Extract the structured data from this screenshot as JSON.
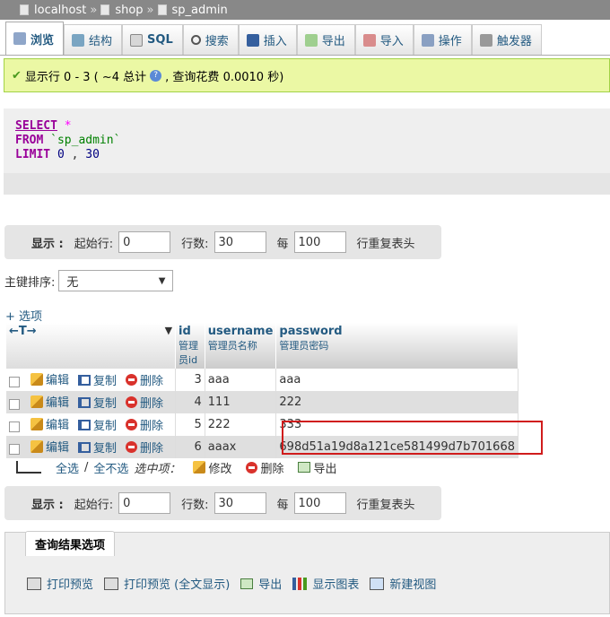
{
  "breadcrumb": {
    "server": "localhost",
    "database": "shop",
    "table": "sp_admin",
    "separator": "»"
  },
  "tabs": [
    {
      "label": "浏览",
      "icon": "browse-icon",
      "active": true
    },
    {
      "label": "结构",
      "icon": "structure-icon"
    },
    {
      "label": "SQL",
      "icon": "sql-icon"
    },
    {
      "label": "搜索",
      "icon": "search-icon"
    },
    {
      "label": "插入",
      "icon": "insert-icon"
    },
    {
      "label": "导出",
      "icon": "export-icon"
    },
    {
      "label": "导入",
      "icon": "import-icon"
    },
    {
      "label": "操作",
      "icon": "wrench-icon"
    },
    {
      "label": "触发器",
      "icon": "trigger-icon"
    }
  ],
  "success": {
    "text_a": "显示行 0 - 3 ( ~4 总计",
    "text_b": ", 查询花费 0.0010 秒)"
  },
  "sql": {
    "select": "SELECT",
    "star": "*",
    "from": "FROM",
    "table": "`sp_admin`",
    "limit": "LIMIT",
    "offset": "0",
    "comma": ",",
    "count": "30"
  },
  "nav": {
    "show_label": "显示 :",
    "start_label": "起始行:",
    "start_value": "0",
    "rows_label": "行数:",
    "rows_value": "30",
    "every_label": "每",
    "every_value": "100",
    "repeat_label": "行重复表头"
  },
  "sort": {
    "label": "主键排序:",
    "value": "无"
  },
  "options_link": "+ 选项",
  "table": {
    "arrows": "←T→",
    "columns": [
      {
        "name": "id",
        "comment": "管理员id"
      },
      {
        "name": "username",
        "comment": "管理员名称"
      },
      {
        "name": "password",
        "comment": "管理员密码"
      }
    ],
    "actions": {
      "edit": "编辑",
      "copy": "复制",
      "delete": "删除"
    },
    "rows": [
      {
        "id": "3",
        "username": "aaa",
        "password": "aaa"
      },
      {
        "id": "4",
        "username": "111",
        "password": "222"
      },
      {
        "id": "5",
        "username": "222",
        "password": "333"
      },
      {
        "id": "6",
        "username": "aaax",
        "password": "698d51a19d8a121ce581499d7b701668"
      }
    ]
  },
  "bulk": {
    "check_all": "全选",
    "slash": "/",
    "uncheck_all": "全不选",
    "selected": "选中项：",
    "edit": "修改",
    "delete": "删除",
    "export": "导出"
  },
  "query_options": {
    "title": "查询结果选项",
    "links": [
      "打印预览",
      "打印预览 (全文显示)",
      "导出",
      "显示图表",
      "新建视图"
    ]
  },
  "colors": {
    "link": "#235a81",
    "success_bg": "#ebf8a4",
    "highlight": "#d01c1c"
  }
}
